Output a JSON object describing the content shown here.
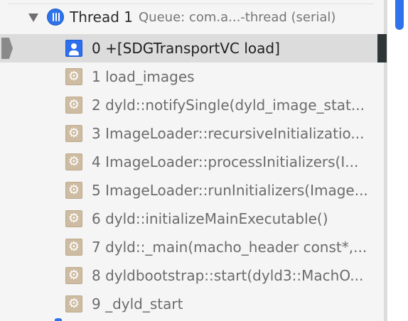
{
  "thread": {
    "name": "Thread 1",
    "queue": "Queue: com.a...-thread (serial)"
  },
  "frames": [
    {
      "label": "0 +[SDGTransportVC load]",
      "icon": "user-code-icon",
      "selected": true
    },
    {
      "label": "1 load_images",
      "icon": "system-gear-icon",
      "selected": false
    },
    {
      "label": "2 dyld::notifySingle(dyld_image_stat...",
      "icon": "system-gear-icon",
      "selected": false
    },
    {
      "label": "3 ImageLoader::recursiveInitializatio...",
      "icon": "system-gear-icon",
      "selected": false
    },
    {
      "label": "4 ImageLoader::processInitializers(I...",
      "icon": "system-gear-icon",
      "selected": false
    },
    {
      "label": "5 ImageLoader::runInitializers(Image...",
      "icon": "system-gear-icon",
      "selected": false
    },
    {
      "label": "6 dyld::initializeMainExecutable()",
      "icon": "system-gear-icon",
      "selected": false
    },
    {
      "label": "7 dyld::_main(macho_header const*,...",
      "icon": "system-gear-icon",
      "selected": false
    },
    {
      "label": "8 dyldbootstrap::start(dyld3::MachO...",
      "icon": "system-gear-icon",
      "selected": false
    },
    {
      "label": "9 _dyld_start",
      "icon": "system-gear-icon",
      "selected": false
    }
  ],
  "icons": {
    "thread": "thread-icon",
    "disclosure": "disclosure-triangle-icon",
    "user": "user-code-icon",
    "system": "system-gear-icon",
    "gear_glyph": "⚙"
  },
  "colors": {
    "accent": "#2e73ea",
    "selection": "#dcdcdc",
    "system_icon": "#cdbca2",
    "text": "#2b2b2b",
    "secondary_text": "#767676"
  }
}
